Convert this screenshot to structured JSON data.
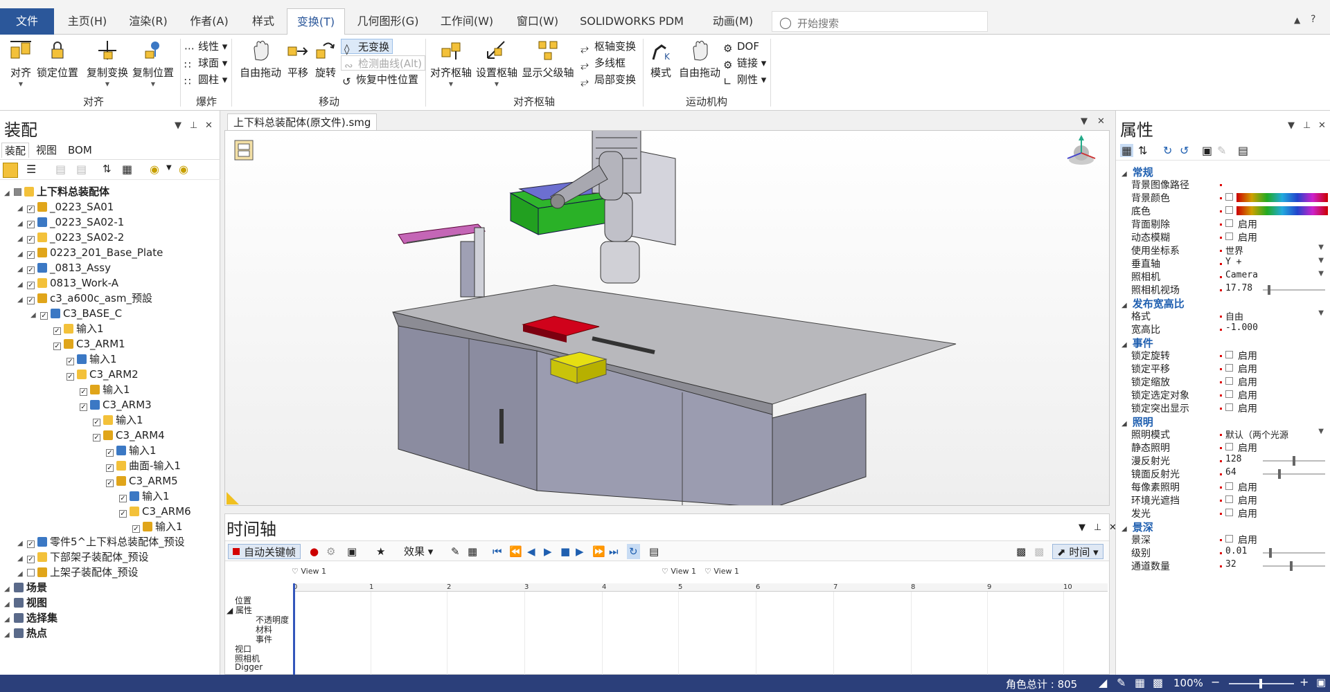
{
  "ribbon": {
    "tabs": [
      "文件",
      "主页(H)",
      "渲染(R)",
      "作者(A)",
      "样式",
      "变换(T)",
      "几何图形(G)",
      "工作间(W)",
      "窗口(W)",
      "SOLIDWORKS PDM",
      "动画(M)"
    ],
    "search_placeholder": "开始搜索",
    "groups": {
      "align": {
        "label": "对齐",
        "buttons": [
          "对齐",
          "锁定位置",
          "复制变换",
          "复制位置"
        ]
      },
      "explode": {
        "label": "爆炸",
        "items": [
          "线性",
          "球面",
          "圆柱"
        ]
      },
      "move": {
        "label": "移动",
        "buttons": [
          "自由拖动",
          "平移",
          "旋转"
        ],
        "small": [
          "无变换",
          "检测曲线(Alt)",
          "恢复中性位置"
        ]
      },
      "pivot": {
        "label": "对齐枢轴",
        "buttons": [
          "对齐枢轴",
          "设置枢轴",
          "显示父级轴"
        ],
        "small": [
          "枢轴变换",
          "多线框",
          "局部变换"
        ]
      },
      "mechanism": {
        "label": "运动机构",
        "buttons": [
          "模式",
          "自由拖动"
        ],
        "small": [
          "DOF",
          "链接",
          "刚性"
        ]
      }
    }
  },
  "left_panel": {
    "title": "装配",
    "tabs": [
      "装配",
      "视图",
      "BOM"
    ],
    "tree": [
      {
        "label": "上下料总装配体",
        "indent": 0,
        "bold": true
      },
      {
        "label": "_0223_SA01",
        "indent": 1
      },
      {
        "label": "_0223_SA02-1",
        "indent": 1
      },
      {
        "label": "_0223_SA02-2",
        "indent": 1
      },
      {
        "label": "0223_201_Base_Plate",
        "indent": 1
      },
      {
        "label": "_0813_Assy",
        "indent": 1
      },
      {
        "label": "0813_Work-A",
        "indent": 1
      },
      {
        "label": "c3_a600c_asm_预設",
        "indent": 1
      },
      {
        "label": "C3_BASE_C",
        "indent": 2
      },
      {
        "label": "输入1",
        "indent": 3
      },
      {
        "label": "C3_ARM1",
        "indent": 3
      },
      {
        "label": "输入1",
        "indent": 4
      },
      {
        "label": "C3_ARM2",
        "indent": 4
      },
      {
        "label": "输入1",
        "indent": 5
      },
      {
        "label": "C3_ARM3",
        "indent": 5
      },
      {
        "label": "输入1",
        "indent": 6
      },
      {
        "label": "C3_ARM4",
        "indent": 6
      },
      {
        "label": "输入1",
        "indent": 7
      },
      {
        "label": "曲面-输入1",
        "indent": 7
      },
      {
        "label": "C3_ARM5",
        "indent": 7
      },
      {
        "label": "输入1",
        "indent": 8
      },
      {
        "label": "C3_ARM6",
        "indent": 8
      },
      {
        "label": "输入1",
        "indent": 9
      },
      {
        "label": "零件5^上下料总装配体_预设",
        "indent": 1
      },
      {
        "label": "下部架子装配体_预设",
        "indent": 1
      },
      {
        "label": "上架子装配体_预设",
        "indent": 1
      },
      {
        "label": "场景",
        "indent": 0,
        "bold": true
      },
      {
        "label": "视图",
        "indent": 0,
        "bold": true
      },
      {
        "label": "选择集",
        "indent": 0,
        "bold": true
      },
      {
        "label": "热点",
        "indent": 0,
        "bold": true
      }
    ]
  },
  "document": {
    "tab_title": "上下料总装配体(原文件).smg"
  },
  "timeline": {
    "title": "时间轴",
    "auto_key": "自动关键帧",
    "effects": "效果",
    "time_mode": "时间",
    "view_marks": [
      "View 1",
      "View 1",
      "View 1"
    ],
    "ticks": [
      "0",
      "1",
      "2",
      "3",
      "4",
      "5",
      "6",
      "7",
      "8",
      "9",
      "10"
    ],
    "tracks": [
      "位置",
      "属性",
      "不透明度",
      "材料",
      "事件",
      "视口",
      "照相机",
      "Digger"
    ]
  },
  "properties": {
    "title": "属性",
    "sections": [
      {
        "cat": "常规",
        "rows": [
          {
            "k": "背景图像路径"
          },
          {
            "k": "背景颜色",
            "type": "color"
          },
          {
            "k": "底色",
            "type": "color"
          },
          {
            "k": "背面剔除",
            "type": "chk",
            "v": "启用"
          },
          {
            "k": "动态模糊",
            "type": "chk",
            "v": "启用"
          },
          {
            "k": "使用坐标系",
            "v": "世界",
            "dd": true
          },
          {
            "k": "垂直轴",
            "v": "Y +",
            "dd": true
          },
          {
            "k": "照相机",
            "v": "Camera",
            "dd": true
          },
          {
            "k": "照相机视场",
            "v": "17.78",
            "type": "slider",
            "level": 0.08
          }
        ]
      },
      {
        "cat": "发布宽高比",
        "rows": [
          {
            "k": "格式",
            "v": "自由",
            "dd": true
          },
          {
            "k": "宽高比",
            "v": "-1.000"
          }
        ]
      },
      {
        "cat": "事件",
        "rows": [
          {
            "k": "锁定旋转",
            "type": "chk",
            "v": "启用"
          },
          {
            "k": "锁定平移",
            "type": "chk",
            "v": "启用"
          },
          {
            "k": "锁定缩放",
            "type": "chk",
            "v": "启用"
          },
          {
            "k": "锁定选定对象",
            "type": "chk",
            "v": "启用"
          },
          {
            "k": "锁定突出显示",
            "type": "chk",
            "v": "启用"
          }
        ]
      },
      {
        "cat": "照明",
        "rows": [
          {
            "k": "照明模式",
            "v": "默认（两个光源",
            "dd": true
          },
          {
            "k": "静态照明",
            "type": "chk",
            "v": "启用"
          },
          {
            "k": "漫反射光",
            "v": "128",
            "type": "slider",
            "level": 0.5
          },
          {
            "k": "镜面反射光",
            "v": "64",
            "type": "slider",
            "level": 0.25
          },
          {
            "k": "每像素照明",
            "type": "chk",
            "v": "启用"
          },
          {
            "k": "环境光遮挡",
            "type": "chk",
            "v": "启用"
          },
          {
            "k": "发光",
            "type": "chk",
            "v": "启用"
          }
        ]
      },
      {
        "cat": "景深",
        "rows": [
          {
            "k": "景深",
            "type": "chk",
            "v": "启用"
          },
          {
            "k": "级别",
            "v": "0.01",
            "type": "slider",
            "level": 0.1
          },
          {
            "k": "通道数量",
            "v": "32",
            "type": "slider",
            "level": 0.45
          }
        ]
      }
    ]
  },
  "status": {
    "count_label": "角色总计 : 805",
    "zoom": "100%"
  }
}
